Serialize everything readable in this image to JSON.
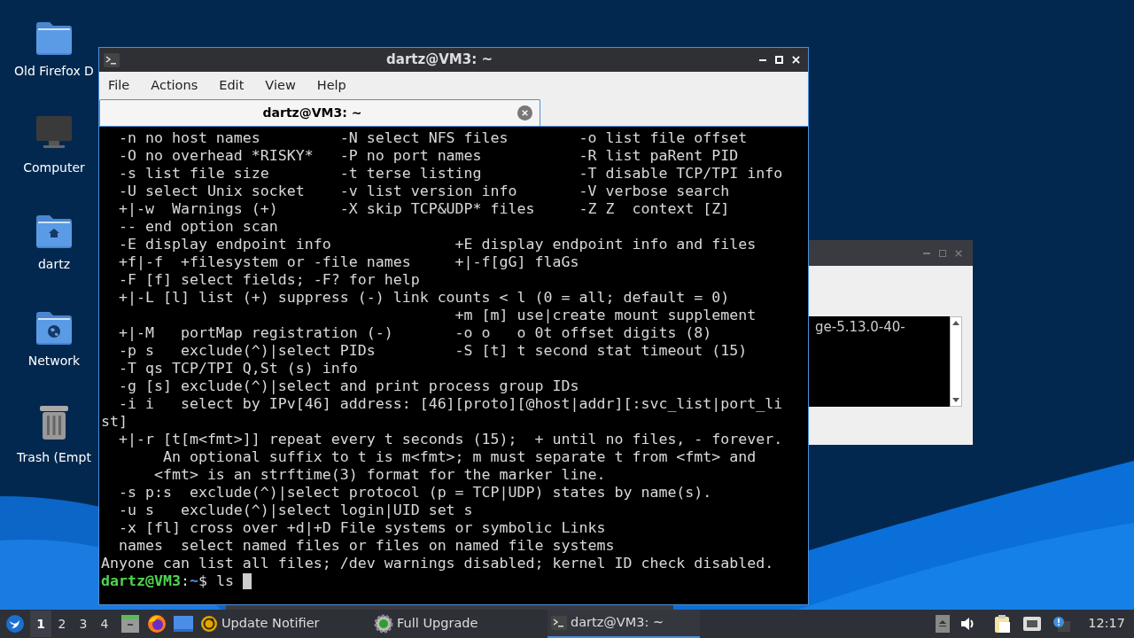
{
  "desktop_icons": [
    {
      "label": "Old Firefox D",
      "kind": "folder"
    },
    {
      "label": "Computer",
      "kind": "computer"
    },
    {
      "label": "dartz",
      "kind": "home"
    },
    {
      "label": "Network",
      "kind": "network"
    },
    {
      "label": "Trash (Empt",
      "kind": "trash"
    }
  ],
  "background_window": {
    "text": "ge-5.13.0-40-"
  },
  "terminal": {
    "title": "dartz@VM3: ~",
    "menu": [
      "File",
      "Actions",
      "Edit",
      "View",
      "Help"
    ],
    "tabs": [
      {
        "label": "dartz@VM3: ~",
        "selected": true
      }
    ],
    "lines": [
      "  -n no host names         -N select NFS files        -o list file offset",
      "  -O no overhead *RISKY*   -P no port names           -R list paRent PID",
      "  -s list file size        -t terse listing           -T disable TCP/TPI info",
      "  -U select Unix socket    -v list version info       -V verbose search",
      "  +|-w  Warnings (+)       -X skip TCP&UDP* files     -Z Z  context [Z]",
      "  -- end option scan",
      "  -E display endpoint info              +E display endpoint info and files",
      "  +f|-f  +filesystem or -file names     +|-f[gG] flaGs",
      "  -F [f] select fields; -F? for help",
      "  +|-L [l] list (+) suppress (-) link counts < l (0 = all; default = 0)",
      "                                        +m [m] use|create mount supplement",
      "  +|-M   portMap registration (-)       -o o   o 0t offset digits (8)",
      "  -p s   exclude(^)|select PIDs         -S [t] t second stat timeout (15)",
      "  -T qs TCP/TPI Q,St (s) info",
      "  -g [s] exclude(^)|select and print process group IDs",
      "  -i i   select by IPv[46] address: [46][proto][@host|addr][:svc_list|port_li",
      "st]",
      "  +|-r [t[m<fmt>]] repeat every t seconds (15);  + until no files, - forever.",
      "       An optional suffix to t is m<fmt>; m must separate t from <fmt> and",
      "      <fmt> is an strftime(3) format for the marker line.",
      "  -s p:s  exclude(^)|select protocol (p = TCP|UDP) states by name(s).",
      "  -u s   exclude(^)|select login|UID set s",
      "  -x [fl] cross over +d|+D File systems or symbolic Links",
      "  names  select named files or files on named file systems",
      "Anyone can list all files; /dev warnings disabled; kernel ID check disabled."
    ],
    "prompt": {
      "user_host": "dartz@VM3",
      "separator": ":",
      "path": "~",
      "symbol": "$",
      "command": "ls"
    }
  },
  "taskbar": {
    "workspaces": [
      {
        "label": "1",
        "selected": true
      },
      {
        "label": "2",
        "selected": false
      },
      {
        "label": "3",
        "selected": false
      },
      {
        "label": "4",
        "selected": false
      }
    ],
    "tasks": [
      {
        "label": "Update Notifier",
        "kind": "update",
        "selected": false
      },
      {
        "label": "Full Upgrade",
        "kind": "gear",
        "selected": false
      },
      {
        "label": "dartz@VM3: ~",
        "kind": "terminal",
        "selected": true
      }
    ],
    "clock": "12:17"
  }
}
